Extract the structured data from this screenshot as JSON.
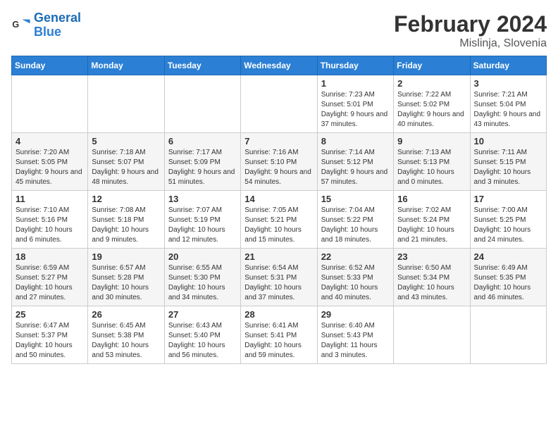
{
  "header": {
    "logo_line1": "General",
    "logo_line2": "Blue",
    "month_title": "February 2024",
    "subtitle": "Mislinja, Slovenia"
  },
  "weekdays": [
    "Sunday",
    "Monday",
    "Tuesday",
    "Wednesday",
    "Thursday",
    "Friday",
    "Saturday"
  ],
  "weeks": [
    [
      {
        "day": "",
        "info": ""
      },
      {
        "day": "",
        "info": ""
      },
      {
        "day": "",
        "info": ""
      },
      {
        "day": "",
        "info": ""
      },
      {
        "day": "1",
        "info": "Sunrise: 7:23 AM\nSunset: 5:01 PM\nDaylight: 9 hours and 37 minutes."
      },
      {
        "day": "2",
        "info": "Sunrise: 7:22 AM\nSunset: 5:02 PM\nDaylight: 9 hours and 40 minutes."
      },
      {
        "day": "3",
        "info": "Sunrise: 7:21 AM\nSunset: 5:04 PM\nDaylight: 9 hours and 43 minutes."
      }
    ],
    [
      {
        "day": "4",
        "info": "Sunrise: 7:20 AM\nSunset: 5:05 PM\nDaylight: 9 hours and 45 minutes."
      },
      {
        "day": "5",
        "info": "Sunrise: 7:18 AM\nSunset: 5:07 PM\nDaylight: 9 hours and 48 minutes."
      },
      {
        "day": "6",
        "info": "Sunrise: 7:17 AM\nSunset: 5:09 PM\nDaylight: 9 hours and 51 minutes."
      },
      {
        "day": "7",
        "info": "Sunrise: 7:16 AM\nSunset: 5:10 PM\nDaylight: 9 hours and 54 minutes."
      },
      {
        "day": "8",
        "info": "Sunrise: 7:14 AM\nSunset: 5:12 PM\nDaylight: 9 hours and 57 minutes."
      },
      {
        "day": "9",
        "info": "Sunrise: 7:13 AM\nSunset: 5:13 PM\nDaylight: 10 hours and 0 minutes."
      },
      {
        "day": "10",
        "info": "Sunrise: 7:11 AM\nSunset: 5:15 PM\nDaylight: 10 hours and 3 minutes."
      }
    ],
    [
      {
        "day": "11",
        "info": "Sunrise: 7:10 AM\nSunset: 5:16 PM\nDaylight: 10 hours and 6 minutes."
      },
      {
        "day": "12",
        "info": "Sunrise: 7:08 AM\nSunset: 5:18 PM\nDaylight: 10 hours and 9 minutes."
      },
      {
        "day": "13",
        "info": "Sunrise: 7:07 AM\nSunset: 5:19 PM\nDaylight: 10 hours and 12 minutes."
      },
      {
        "day": "14",
        "info": "Sunrise: 7:05 AM\nSunset: 5:21 PM\nDaylight: 10 hours and 15 minutes."
      },
      {
        "day": "15",
        "info": "Sunrise: 7:04 AM\nSunset: 5:22 PM\nDaylight: 10 hours and 18 minutes."
      },
      {
        "day": "16",
        "info": "Sunrise: 7:02 AM\nSunset: 5:24 PM\nDaylight: 10 hours and 21 minutes."
      },
      {
        "day": "17",
        "info": "Sunrise: 7:00 AM\nSunset: 5:25 PM\nDaylight: 10 hours and 24 minutes."
      }
    ],
    [
      {
        "day": "18",
        "info": "Sunrise: 6:59 AM\nSunset: 5:27 PM\nDaylight: 10 hours and 27 minutes."
      },
      {
        "day": "19",
        "info": "Sunrise: 6:57 AM\nSunset: 5:28 PM\nDaylight: 10 hours and 30 minutes."
      },
      {
        "day": "20",
        "info": "Sunrise: 6:55 AM\nSunset: 5:30 PM\nDaylight: 10 hours and 34 minutes."
      },
      {
        "day": "21",
        "info": "Sunrise: 6:54 AM\nSunset: 5:31 PM\nDaylight: 10 hours and 37 minutes."
      },
      {
        "day": "22",
        "info": "Sunrise: 6:52 AM\nSunset: 5:33 PM\nDaylight: 10 hours and 40 minutes."
      },
      {
        "day": "23",
        "info": "Sunrise: 6:50 AM\nSunset: 5:34 PM\nDaylight: 10 hours and 43 minutes."
      },
      {
        "day": "24",
        "info": "Sunrise: 6:49 AM\nSunset: 5:35 PM\nDaylight: 10 hours and 46 minutes."
      }
    ],
    [
      {
        "day": "25",
        "info": "Sunrise: 6:47 AM\nSunset: 5:37 PM\nDaylight: 10 hours and 50 minutes."
      },
      {
        "day": "26",
        "info": "Sunrise: 6:45 AM\nSunset: 5:38 PM\nDaylight: 10 hours and 53 minutes."
      },
      {
        "day": "27",
        "info": "Sunrise: 6:43 AM\nSunset: 5:40 PM\nDaylight: 10 hours and 56 minutes."
      },
      {
        "day": "28",
        "info": "Sunrise: 6:41 AM\nSunset: 5:41 PM\nDaylight: 10 hours and 59 minutes."
      },
      {
        "day": "29",
        "info": "Sunrise: 6:40 AM\nSunset: 5:43 PM\nDaylight: 11 hours and 3 minutes."
      },
      {
        "day": "",
        "info": ""
      },
      {
        "day": "",
        "info": ""
      }
    ]
  ]
}
